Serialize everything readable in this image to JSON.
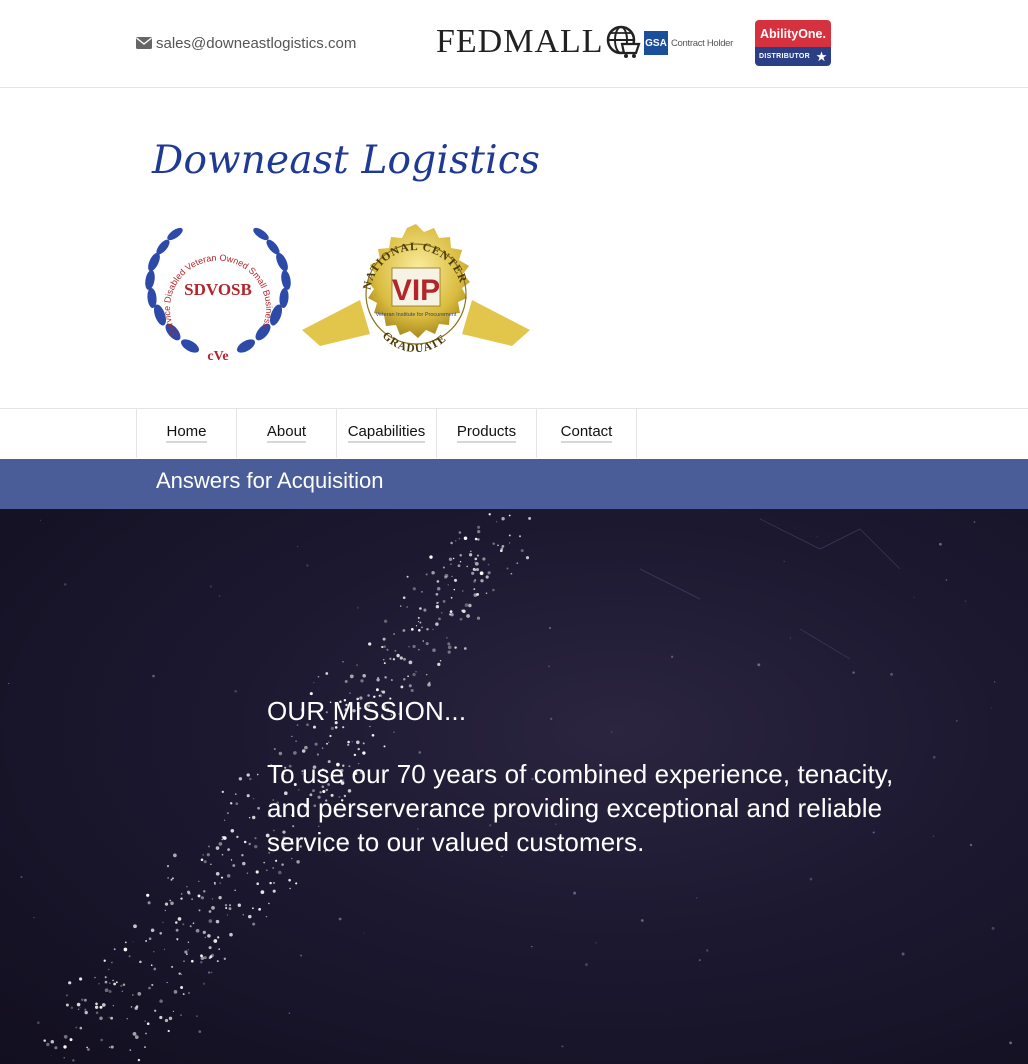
{
  "topbar": {
    "email": "sales@downeastlogistics.com",
    "email_icon": "envelope-icon",
    "fedmall_label": "FEDMALL",
    "gsa_badge": "GSA",
    "gsa_label": "Contract Holder",
    "abilityone_title": "AbilityOne.",
    "abilityone_sub": "DISTRIBUTOR"
  },
  "brand": {
    "name": "Downeast Logistics"
  },
  "badges": {
    "sdvosb": {
      "center": "SDVOSB",
      "ring": "Service Disabled Veteran Owned Small Business",
      "bottom": "cVe"
    },
    "vip": {
      "top": "NATIONAL CENTER",
      "center": "VIP",
      "sub": "Veteran Institute for Procurement",
      "bottom": "GRADUATE"
    }
  },
  "nav": {
    "items": [
      {
        "label": "Home"
      },
      {
        "label": "About"
      },
      {
        "label": "Capabilities"
      },
      {
        "label": "Products"
      },
      {
        "label": "Contact"
      }
    ]
  },
  "banner": {
    "tagline": "Answers for Acquisition"
  },
  "hero": {
    "title": "OUR MISSION...",
    "body": "To use our 70 years of combined experience, tenacity, and perserverance providing exceptional and reliable service to our valued customers."
  },
  "colors": {
    "brand_blue": "#1f3a94",
    "banner": "#4a5d99",
    "hero_bg": "#1c1830"
  }
}
